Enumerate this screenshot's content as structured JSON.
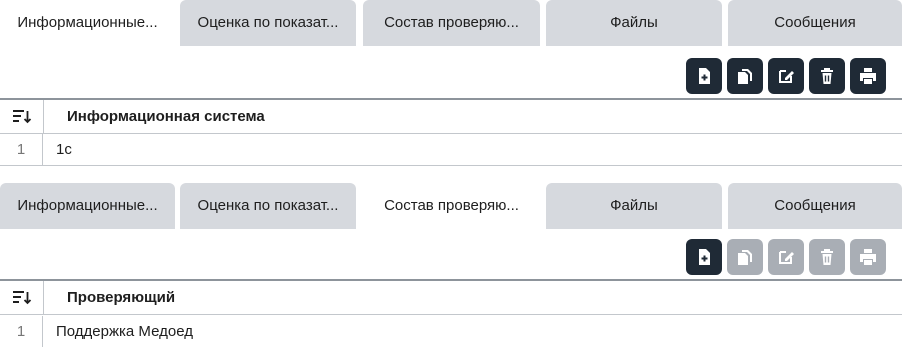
{
  "tabs": [
    "Информационные...",
    "Оценка по показат...",
    "Состав проверяю...",
    "Файлы",
    "Сообщения"
  ],
  "icons": {
    "toolbar": [
      "add-file-icon",
      "copy-icon",
      "edit-icon",
      "delete-icon",
      "print-icon"
    ],
    "sort": "sort-icon"
  },
  "colors": {
    "button_active": "#1f2a36",
    "button_disabled": "#a9aeb5",
    "tab_inactive": "#d6d9de"
  },
  "panel1": {
    "active_tab": 0,
    "column": "Информационная система",
    "rows": [
      {
        "num": "1",
        "value": "1с"
      }
    ],
    "buttons_enabled": [
      true,
      true,
      true,
      true,
      true
    ]
  },
  "panel2": {
    "active_tab": 2,
    "column": "Проверяющий",
    "rows": [
      {
        "num": "1",
        "value": "Поддержка Медоед"
      }
    ],
    "buttons_enabled": [
      true,
      false,
      false,
      false,
      false
    ]
  }
}
